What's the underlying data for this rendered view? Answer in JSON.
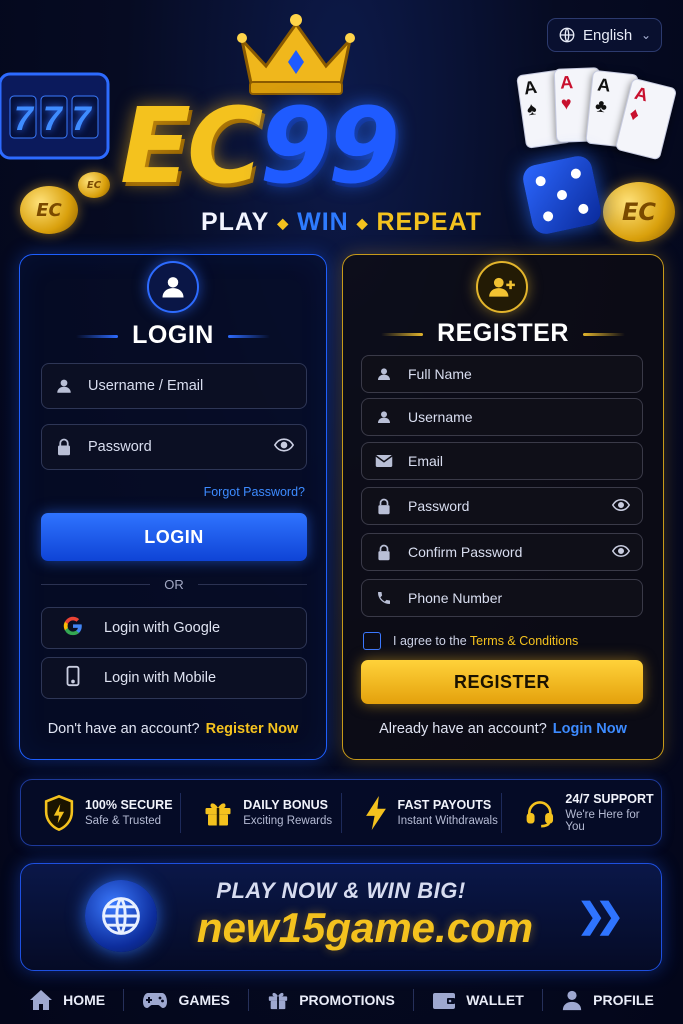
{
  "language": {
    "label": "English"
  },
  "brand": {
    "logo_left": "EC",
    "logo_right": "99",
    "coin_text": "EC",
    "slot_digits": "777",
    "tagline": [
      "PLAY",
      "WIN",
      "REPEAT"
    ]
  },
  "login": {
    "title": "LOGIN",
    "username_placeholder": "Username / Email",
    "password_placeholder": "Password",
    "forgot": "Forgot Password?",
    "button": "LOGIN",
    "or": "OR",
    "google": "Login with Google",
    "mobile": "Login with Mobile",
    "footer_text": "Don't have an account?",
    "footer_link": "Register Now"
  },
  "register": {
    "title": "REGISTER",
    "fields": {
      "full_name": "Full Name",
      "username": "Username",
      "email": "Email",
      "password": "Password",
      "confirm_password": "Confirm Password",
      "phone": "Phone Number"
    },
    "agree_text": "I agree to the",
    "terms": "Terms & Conditions",
    "button": "REGISTER",
    "footer_text": "Already have an account?",
    "footer_link": "Login Now"
  },
  "features": [
    {
      "title": "100% SECURE",
      "subtitle": "Safe & Trusted"
    },
    {
      "title": "DAILY BONUS",
      "subtitle": "Exciting Rewards"
    },
    {
      "title": "FAST PAYOUTS",
      "subtitle": "Instant Withdrawals"
    },
    {
      "title": "24/7 SUPPORT",
      "subtitle": "We're Here for You"
    }
  ],
  "banner": {
    "headline": "PLAY NOW & WIN BIG!",
    "site": "new15game.com"
  },
  "nav": [
    {
      "label": "HOME",
      "icon": "home-icon"
    },
    {
      "label": "GAMES",
      "icon": "gamepad-icon"
    },
    {
      "label": "PROMOTIONS",
      "icon": "gift-icon"
    },
    {
      "label": "WALLET",
      "icon": "wallet-icon"
    },
    {
      "label": "PROFILE",
      "icon": "user-icon"
    }
  ],
  "colors": {
    "gold": "#f4c21e",
    "blue": "#2f74ff",
    "background": "#060b22"
  }
}
